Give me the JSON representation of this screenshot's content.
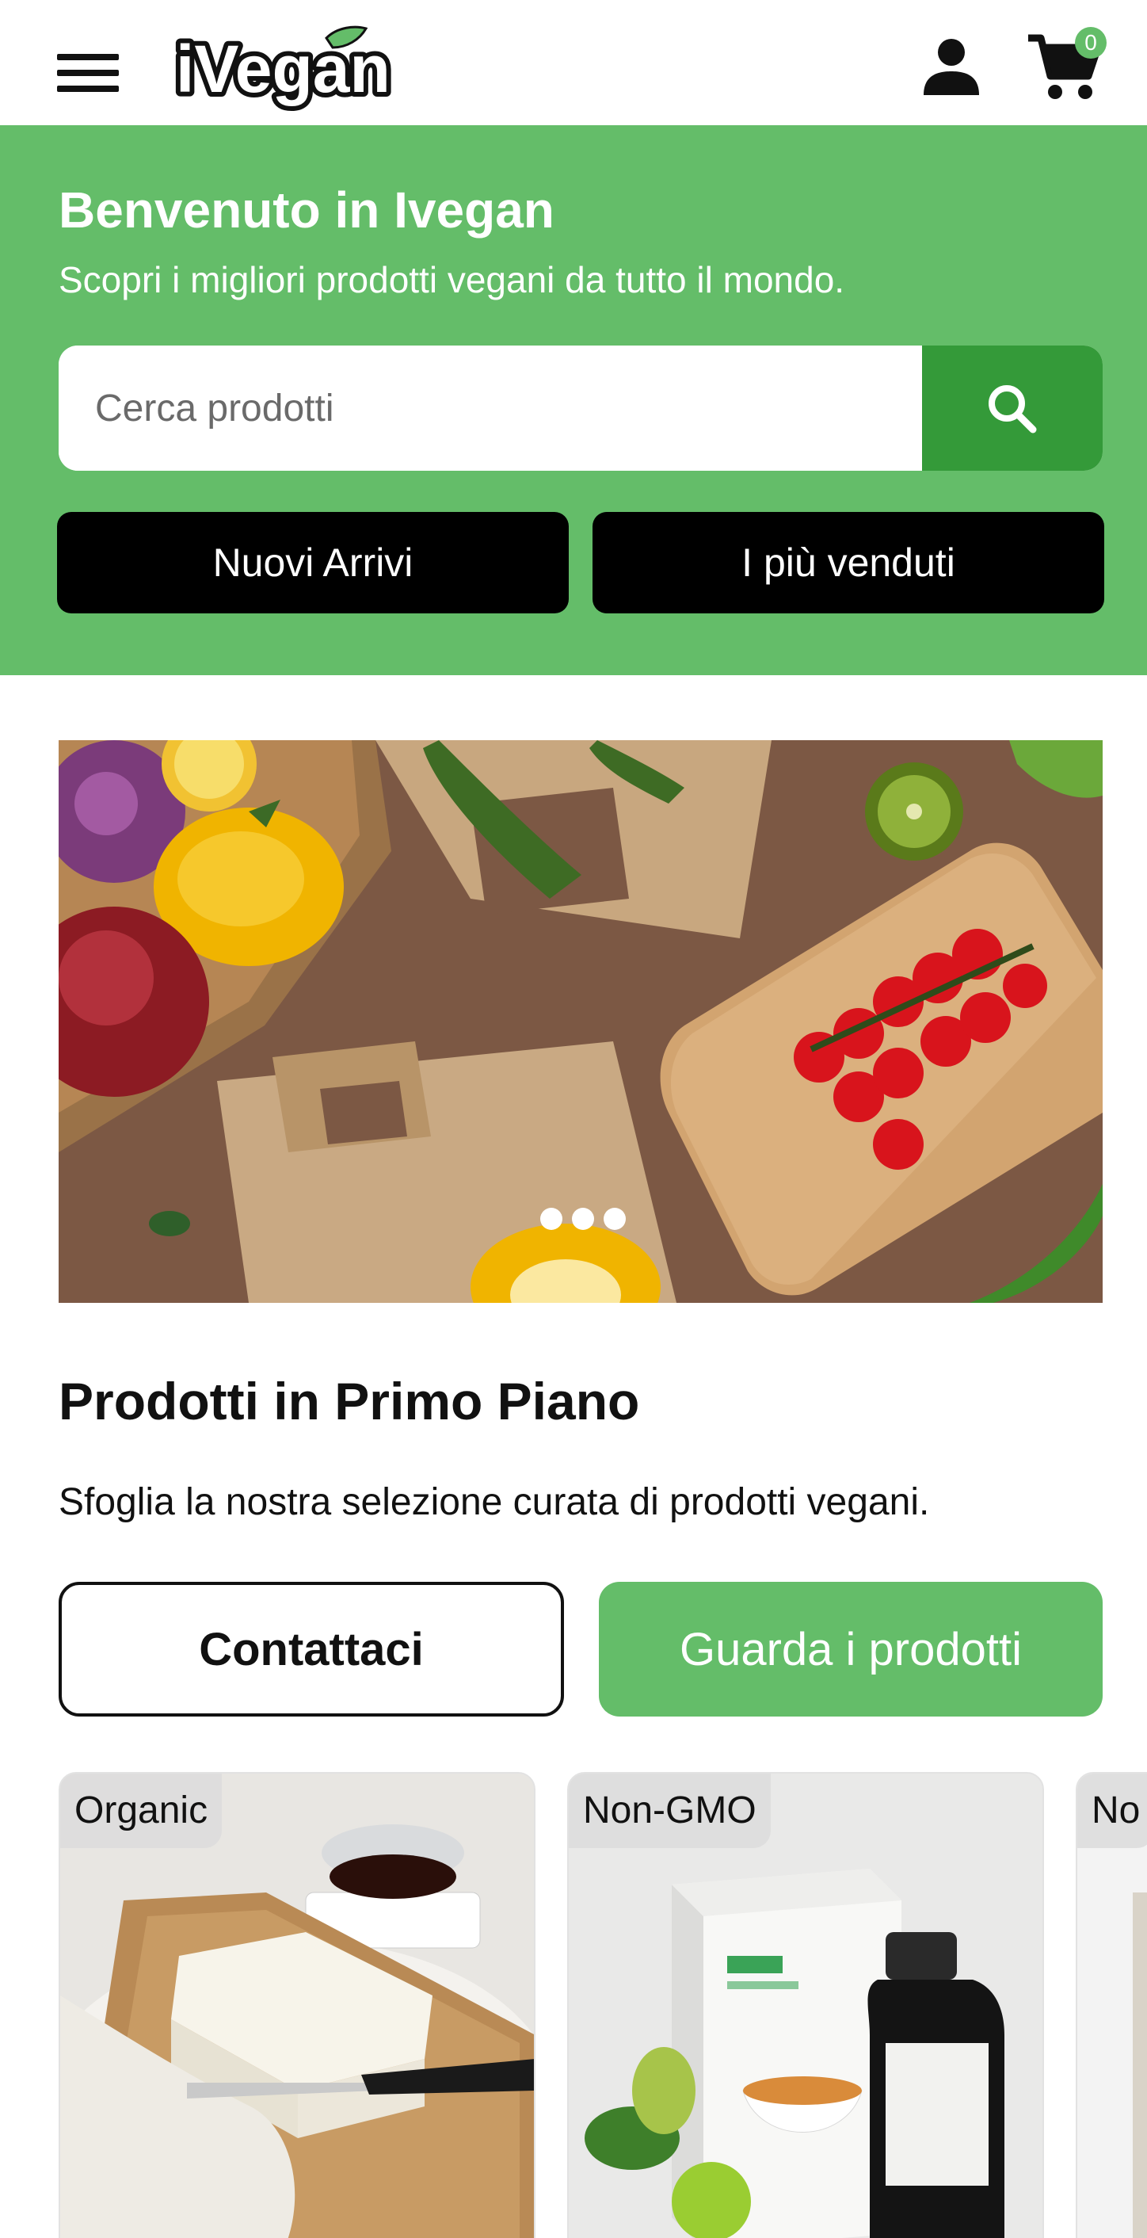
{
  "header": {
    "logo_text": "iVegan",
    "cart_count": "0",
    "icons": {
      "menu": "menu-icon",
      "user": "user-icon",
      "cart": "cart-icon"
    }
  },
  "hero": {
    "title": "Benvenuto in Ivegan",
    "subtitle": "Scopri i migliori prodotti vegani da tutto il mondo.",
    "search": {
      "placeholder": "Cerca prodotti",
      "value": ""
    },
    "buttons": {
      "new_arrivals": "Nuovi Arrivi",
      "best_sellers": "I più venduti"
    }
  },
  "banner": {
    "slides_count": 3,
    "image_description": "vegetables, paper bags and cutting board"
  },
  "featured": {
    "title": "Prodotti in Primo Piano",
    "description": "Sfoglia la nostra selezione curata di prodotti vegani.",
    "contact_label": "Contattaci",
    "view_products_label": "Guarda i prodotti"
  },
  "products": [
    {
      "tag": "Organic"
    },
    {
      "tag": "Non-GMO"
    },
    {
      "tag": "No"
    }
  ],
  "colors": {
    "brand_green": "#64bd69",
    "dark_green": "#349a39",
    "black": "#000000",
    "white": "#ffffff"
  }
}
